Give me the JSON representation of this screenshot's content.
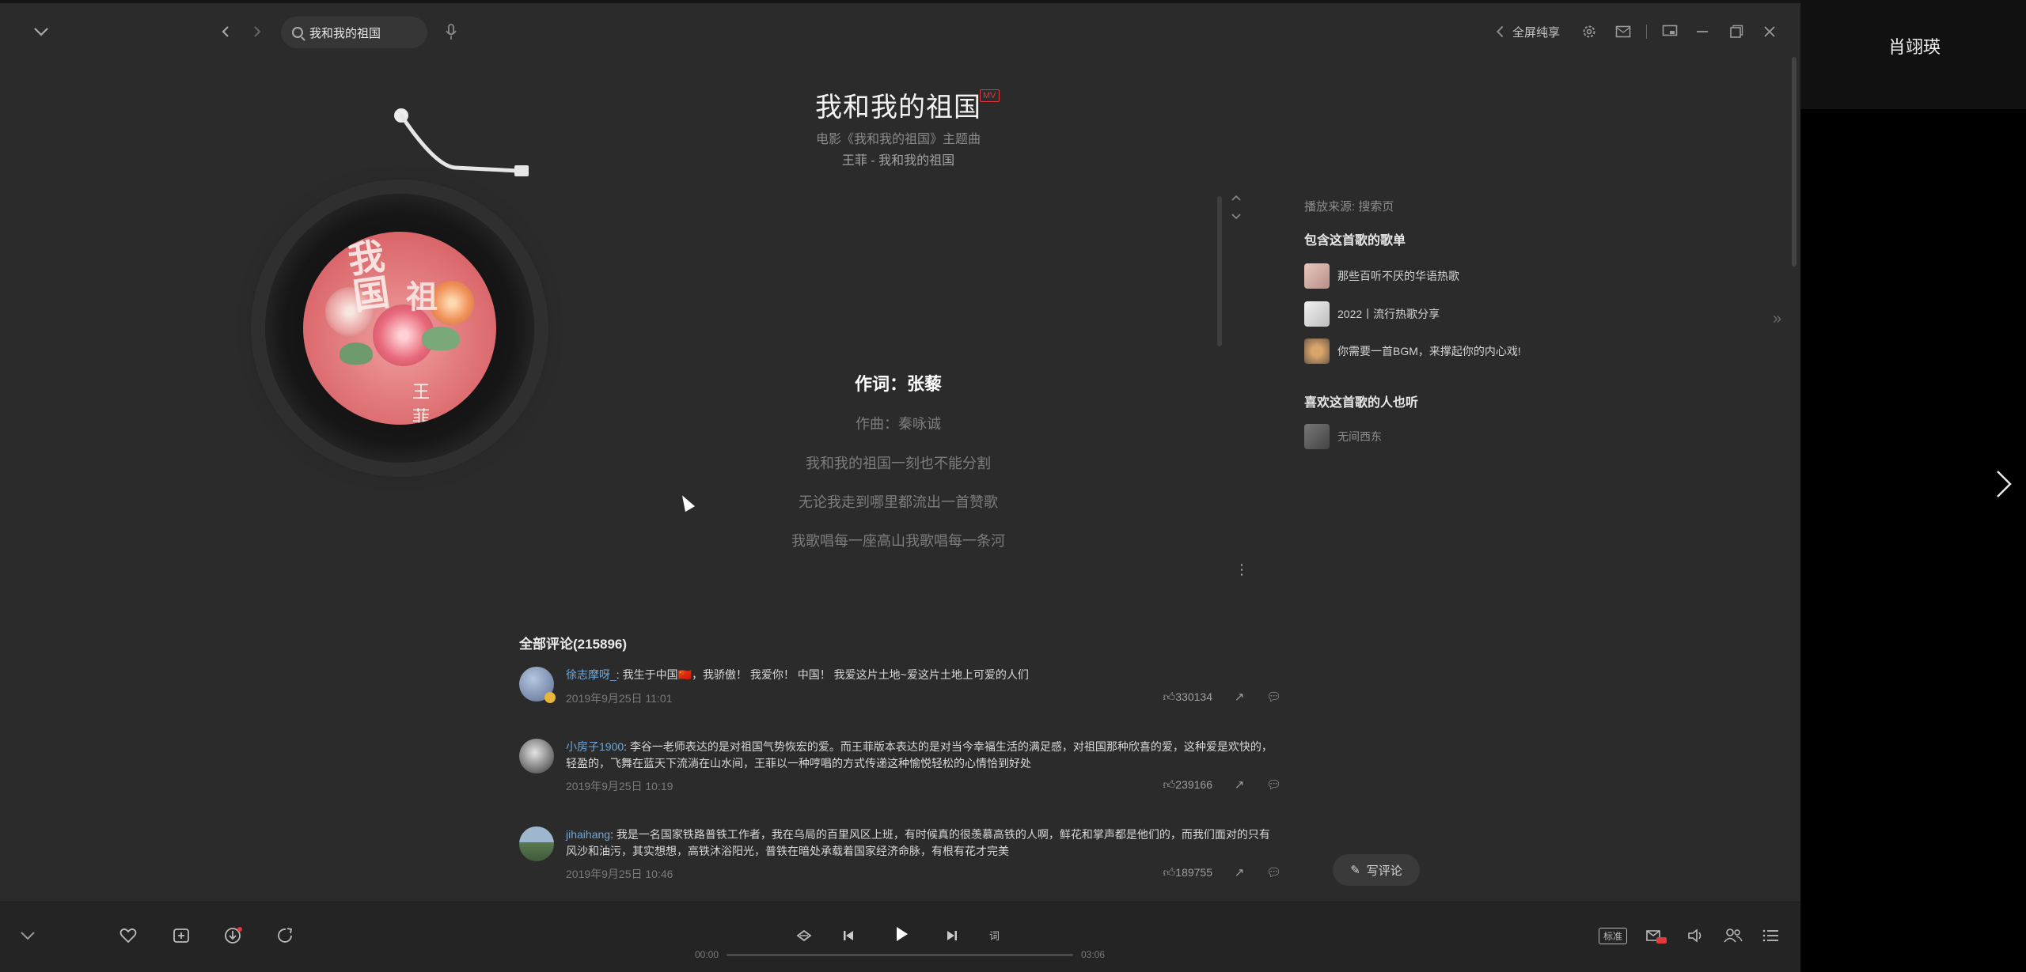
{
  "titlebar": {
    "search_value": "我和我的祖国",
    "fullscreen_label": "全屏纯享",
    "icons": [
      "collapse-icon",
      "back-icon",
      "forward-icon",
      "search-icon",
      "mic-icon",
      "fullscreen-icon",
      "settings-icon",
      "mail-icon",
      "miniplayer-icon",
      "minimize-icon",
      "maximize-icon",
      "close-icon"
    ]
  },
  "song": {
    "title": "我和我的祖国",
    "mv_badge": "MV",
    "subtitle": "电影《我和我的祖国》主题曲",
    "artist_album": "王菲 - 我和我的祖国"
  },
  "lyrics": {
    "lines": [
      "作词：张藜",
      "作曲：秦咏诚",
      "我和我的祖国一刻也不能分割",
      "无论我走到哪里都流出一首赞歌",
      "我歌唱每一座高山我歌唱每一条河"
    ],
    "current_index": 0
  },
  "right_panel": {
    "source": "播放来源: 搜索页",
    "playlists_heading": "包含这首歌的歌单",
    "playlists": [
      "那些百听不厌的华语热歌",
      "2022丨流行热歌分享",
      "你需要一首BGM，来撑起你的内心戏!"
    ],
    "listeners_heading": "喜欢这首歌的人也听",
    "listeners": [
      "无间西东"
    ]
  },
  "comments": {
    "title": "全部评论(215896)",
    "items": [
      {
        "user": "徐志摩呀_",
        "text": "我生于中国🇨🇳，我骄傲！ 我爱你！ 中国！ 我爱这片土地~爱这片土地上可爱的人们",
        "time": "2019年9月25日 11:01",
        "likes": "330134"
      },
      {
        "user": "小房子1900",
        "text": "李谷一老师表达的是对祖国气势恢宏的爱。而王菲版本表达的是对当今幸福生活的满足感，对祖国那种欣喜的爱，这种爱是欢快的，轻盈的，飞舞在蓝天下流淌在山水间，王菲以一种哼唱的方式传递这种愉悦轻松的心情恰到好处",
        "time": "2019年9月25日 10:19",
        "likes": "239166"
      },
      {
        "user": "jihaihang",
        "text": "我是一名国家铁路普铁工作者，我在乌局的百里风区上班，有时候真的很羡慕高铁的人啊，鲜花和掌声都是他们的，而我们面对的只有风沙和油污，其实想想，高铁沐浴阳光，普铁在暗处承载着国家经济命脉，有根有花才完美",
        "time": "2019年9月25日 10:46",
        "likes": "189755"
      }
    ],
    "write_label": "写评论"
  },
  "player": {
    "current_time": "00:00",
    "total_time": "03:06",
    "progress": 0,
    "quality": "标准",
    "icons": [
      "collapse-icon",
      "like-icon",
      "add-to-playlist-icon",
      "download-icon",
      "share-icon",
      "mode-icon",
      "prev-icon",
      "play-icon",
      "next-icon",
      "lyrics-icon",
      "effects-icon",
      "volume-icon",
      "listen-together-icon",
      "playlist-icon"
    ]
  },
  "side": {
    "username": "肖翊瑛"
  },
  "colors": {
    "background": "#2b2b2b",
    "player_bar": "#242424",
    "accent_red": "#e3383c",
    "username_blue": "#6ea8dc"
  }
}
